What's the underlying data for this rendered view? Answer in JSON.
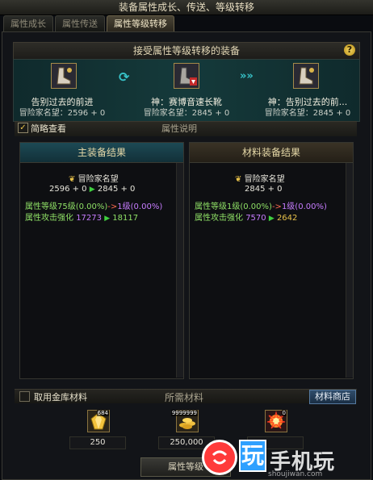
{
  "window": {
    "title": "装备属性成长、传送、等级转移"
  },
  "tabs": [
    {
      "label": "属性成长",
      "active": false
    },
    {
      "label": "属性传送",
      "active": false
    },
    {
      "label": "属性等级转移",
      "active": true
    }
  ],
  "header": {
    "title": "接受属性等级转移的装备",
    "help_label": "?"
  },
  "banner": {
    "left_item": {
      "name": "告别过去的前进",
      "stat": "冒险家名望：2596 + 0",
      "icon": "boots-icon"
    },
    "mid_item": {
      "name": "神：赛博音速长靴",
      "stat": "冒险家名望：2845 + 0",
      "icon": "boots-icon"
    },
    "right_item": {
      "name": "神：告别过去的前...",
      "stat": "冒险家名望：2845 + 0",
      "icon": "boots-icon"
    }
  },
  "options": {
    "brief_view_label": "简略查看",
    "brief_view_checked": true,
    "attr_desc_label": "属性说明"
  },
  "main_result": {
    "title": "主装备结果",
    "fame_label": "冒险家名望",
    "fame_from": "2596 + 0",
    "fame_to": "2845 + 0",
    "level_label": "属性等级75级(0.00%)",
    "level_arrow": "->",
    "level_to": "1级(0.00%)",
    "attack_label": "属性攻击强化",
    "attack_from": "17273",
    "attack_to": "18117"
  },
  "material_result": {
    "title": "材料装备结果",
    "fame_label": "冒险家名望",
    "fame_value": "2845 + 0",
    "level_label": "属性等级1级(0.00%)",
    "level_arrow": "->",
    "level_to": "1级(0.00%)",
    "attack_label": "属性攻击强化",
    "attack_from": "7570",
    "attack_to": "2642"
  },
  "materials": {
    "use_vault_label": "取用金库材料",
    "use_vault_checked": false,
    "required_label": "所需材料",
    "shop_label": "材料商店",
    "items": [
      {
        "icon": "gold-crystal-icon",
        "qty": "684",
        "cost": "250"
      },
      {
        "icon": "gold-coins-icon",
        "qty": "9999999",
        "cost": "250,000"
      },
      {
        "icon": "burst-orb-icon",
        "qty": "0",
        "cost": ""
      }
    ]
  },
  "action": {
    "label": "属性等级"
  },
  "watermark": {
    "box_char": "玩",
    "text": "手机玩",
    "url": "shoujiwan.com"
  }
}
